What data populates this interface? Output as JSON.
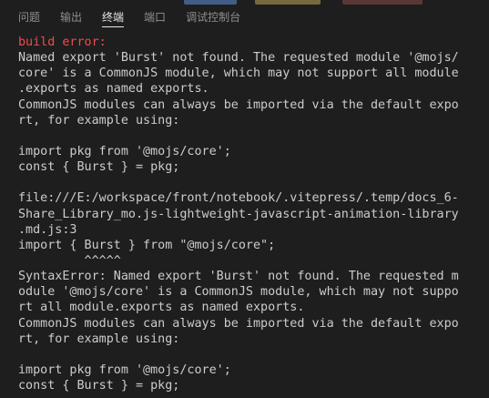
{
  "tabs": [
    {
      "label": "问题",
      "active": false
    },
    {
      "label": "输出",
      "active": false
    },
    {
      "label": "终端",
      "active": true
    },
    {
      "label": "端口",
      "active": false
    },
    {
      "label": "调试控制台",
      "active": false
    }
  ],
  "terminal": {
    "lines": [
      "build error:",
      "Named export 'Burst' not found. The requested module '@mojs/",
      "core' is a CommonJS module, which may not support all module",
      ".exports as named exports.",
      "CommonJS modules can always be imported via the default expo",
      "rt, for example using:",
      "",
      "import pkg from '@mojs/core';",
      "const { Burst } = pkg;",
      "",
      "file:///E:/workspace/front/notebook/.vitepress/.temp/docs_6-",
      "Share_Library_mo.js-lightweight-javascript-animation-library",
      ".md.js:3",
      "import { Burst } from \"@mojs/core\";",
      "         ^^^^^",
      "SyntaxError: Named export 'Burst' not found. The requested m",
      "odule '@mojs/core' is a CommonJS module, which may not suppo",
      "rt all module.exports as named exports.",
      "CommonJS modules can always be imported via the default expo",
      "rt, for example using:",
      "",
      "import pkg from '@mojs/core';",
      "const { Burst } = pkg;"
    ]
  },
  "colors": {
    "background": "#1e1e1e",
    "text": "#cccccc",
    "error": "#f14c4c",
    "tab_inactive": "#8f8f8f",
    "tab_active": "#e7e7e7"
  }
}
